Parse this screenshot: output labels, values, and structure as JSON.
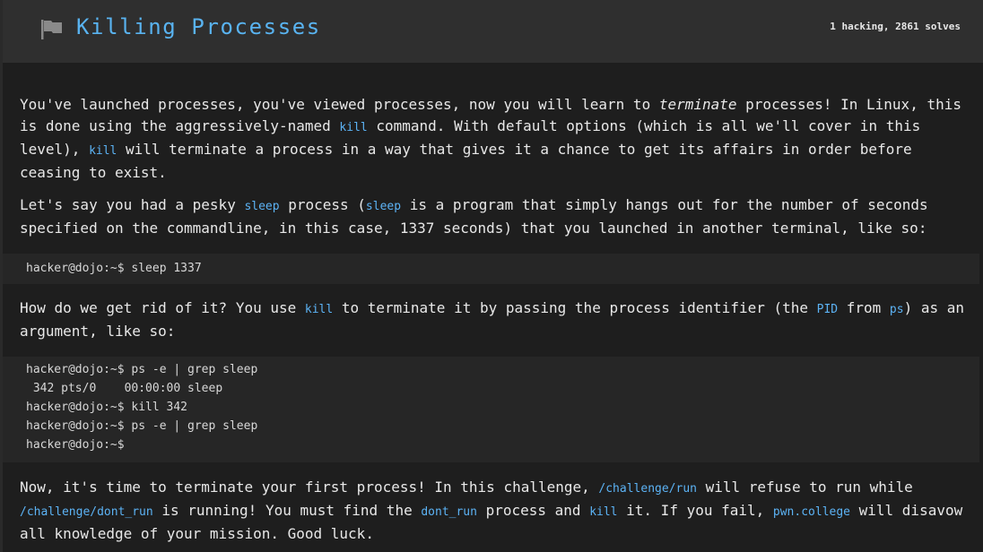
{
  "header": {
    "title": "Killing Processes",
    "stats": "1 hacking, 2861 solves"
  },
  "icons": {
    "flag": "flag-icon"
  },
  "colors": {
    "accent": "#59b3f0",
    "code": "#5cb3f5",
    "background": "#1e1e1e",
    "header_bg": "#2f2f2f",
    "code_block_bg": "#262626"
  },
  "content": {
    "p1": {
      "l1a": "You've launched processes, you've viewed processes, now you will learn to ",
      "l1em": "terminate",
      "l1b": " processes! In Linux, this",
      "l2a": "is done using the aggressively-named ",
      "l2code": "kill",
      "l2b": " command. With default options (which is all we'll cover in this",
      "l3a": "level), ",
      "l3code": "kill",
      "l3b": " will terminate a process in a way that gives it a chance to get its affairs in order before",
      "l4": "ceasing to exist."
    },
    "p2": {
      "l1a": "Let's say you had a pesky ",
      "l1code1": "sleep",
      "l1b": " process (",
      "l1code2": "sleep",
      "l1c": " is a program that simply hangs out for the number of seconds",
      "l2": "specified on the commandline, in this case, 1337 seconds) that you launched in another terminal, like so:"
    },
    "code1": "hacker@dojo:~$ sleep 1337",
    "p3": {
      "l1a": "How do we get rid of it? You use ",
      "l1code1": "kill",
      "l1b": " to terminate it by passing the process identifier (the ",
      "l1code2": "PID",
      "l1c": " from ",
      "l1code3": "ps",
      "l1d": ") as an",
      "l2": "argument, like so:"
    },
    "code2": [
      "hacker@dojo:~$ ps -e | grep sleep",
      " 342 pts/0    00:00:00 sleep",
      "hacker@dojo:~$ kill 342",
      "hacker@dojo:~$ ps -e | grep sleep",
      "hacker@dojo:~$"
    ],
    "p4": {
      "l1a": "Now, it's time to terminate your first process! In this challenge, ",
      "l1code1": "/challenge/run",
      "l1b": " will refuse to run while",
      "l2code1": "/challenge/dont_run",
      "l2a": " is running! You must find the ",
      "l2code2": "dont_run",
      "l2b": " process and ",
      "l2code3": "kill",
      "l2c": " it. If you fail, ",
      "l2code4": "pwn.college",
      "l2d": " will disavow",
      "l3": "all knowledge of your mission. Good luck."
    }
  }
}
